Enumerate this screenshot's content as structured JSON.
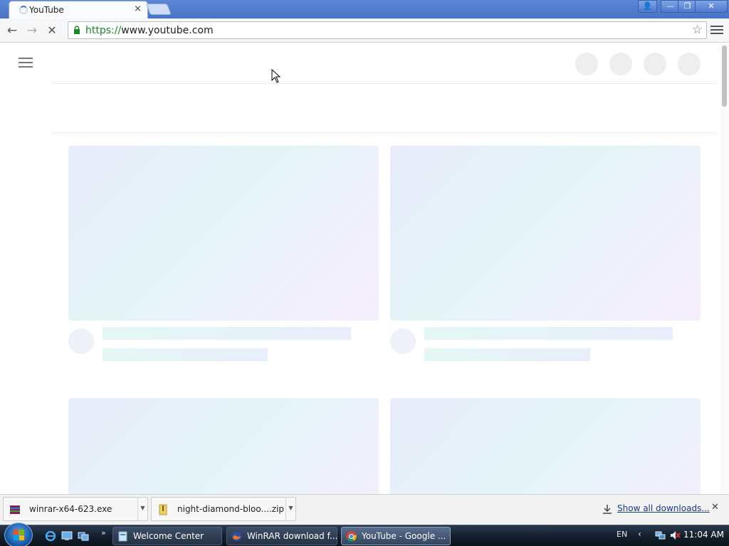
{
  "browser": {
    "tab_title": "YouTube",
    "tab_close": "×",
    "url_scheme": "https://",
    "url_host": "www.youtube.com"
  },
  "window_controls": {
    "user": "👤",
    "minimize": "—",
    "maximize": "❐",
    "close": "✕"
  },
  "nav": {
    "back": "←",
    "forward": "→",
    "reload": "✕",
    "star": "☆"
  },
  "downloads": {
    "items": [
      {
        "name": "winrar-x64-623.exe",
        "icon": "winrar-icon"
      },
      {
        "name": "night-diamond-bloo....zip",
        "icon": "zip-icon"
      }
    ],
    "dropdown": "▼",
    "show_all": "Show all downloads...",
    "close": "✕"
  },
  "taskbar": {
    "quicklaunch_more": "»",
    "tasks": [
      {
        "label": "Welcome Center",
        "icon": "welcome-center-icon"
      },
      {
        "label": "WinRAR download f...",
        "icon": "firefox-icon"
      },
      {
        "label": "YouTube - Google ...",
        "icon": "chrome-icon"
      }
    ],
    "language": "EN",
    "tray_chevron": "‹",
    "clock": "11:04 AM"
  },
  "colors": {
    "titlebar": "#4773c6",
    "url_scheme": "#1a8a27",
    "link": "#1a3a8a",
    "taskbar": "#14202e"
  }
}
